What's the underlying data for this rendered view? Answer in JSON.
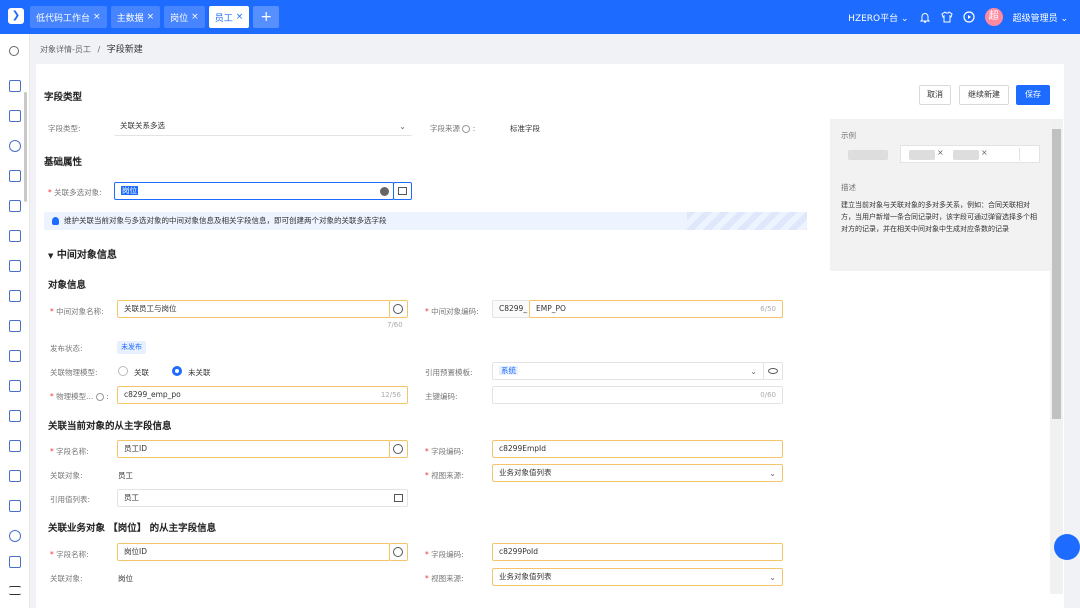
{
  "top": {
    "tabs": [
      {
        "label": "低代码工作台"
      },
      {
        "label": "主数据"
      },
      {
        "label": "岗位"
      },
      {
        "label": "员工"
      }
    ],
    "platform": "HZERO平台",
    "avatar_char": "超",
    "user": "超级管理员",
    "close_glyph": "×",
    "add_glyph": "+",
    "dropdown_glyph": "⌄"
  },
  "breadcrumb": {
    "parent": "对象详情-员工",
    "sep": "/",
    "current": "字段新建"
  },
  "buttons": {
    "cancel": "取消",
    "continue": "继续新建",
    "save": "保存"
  },
  "field_type": {
    "section": "字段类型",
    "type_label": "字段类型:",
    "type_value": "关联关系多选",
    "source_label": "字段来源",
    "source_value": "标准字段"
  },
  "basic": {
    "section": "基础属性",
    "assoc_label": "关联多选对象:",
    "assoc_value": "岗位",
    "notice": "维护关联当前对象与多选对象的中间对象信息及相关字段信息，即可创建两个对象的关联多选字段"
  },
  "middle": {
    "section": "中间对象信息",
    "obj_info": "对象信息",
    "name_label": "中间对象名称:",
    "name_value": "关联员工与岗位",
    "name_count": "7/60",
    "code_label": "中间对象编码:",
    "code_prefix": "C8299_",
    "code_value": "EMP_PO",
    "code_count": "6/50",
    "status_label": "发布状态:",
    "status_value": "未发布",
    "model_label": "关联物理模型:",
    "model_opt1": "关联",
    "model_opt2": "未关联",
    "template_label": "引用预置模板:",
    "template_value": "系统",
    "phys_label": "物理模型...",
    "phys_value": "c8299_emp_po",
    "phys_count": "12/56",
    "pk_label": "主键编码:",
    "pk_count": "0/60"
  },
  "current_sub": {
    "section": "关联当前对象的从主字段信息",
    "fname_label": "字段名称:",
    "fname_value": "员工ID",
    "fcode_label": "字段编码:",
    "fcode_value": "c8299EmpId",
    "obj_label": "关联对象:",
    "obj_value": "员工",
    "view_label": "视图来源:",
    "view_value": "业务对象值列表",
    "list_label": "引用值列表:",
    "list_value": "员工"
  },
  "biz_sub": {
    "section": "关联业务对象 【岗位】 的从主字段信息",
    "fname_label": "字段名称:",
    "fname_value": "岗位ID",
    "fcode_label": "字段编码:",
    "fcode_value": "c8299PoId",
    "obj_label": "关联对象:",
    "obj_value": "岗位",
    "view_label": "视图来源:",
    "view_value": "业务对象值列表"
  },
  "example": {
    "title": "示例",
    "desc_title": "描述",
    "desc": "建立当前对象与关联对象的多对多关系，例如：合同关联相对方，当用户新增一条合同记录时，该字段可通过弹窗选择多个相对方的记录，并在相关中间对象中生成对应条数的记录"
  },
  "colors": {
    "primary": "#1e6bff",
    "highlight_border": "#f3c56a",
    "required": "#e33333"
  }
}
